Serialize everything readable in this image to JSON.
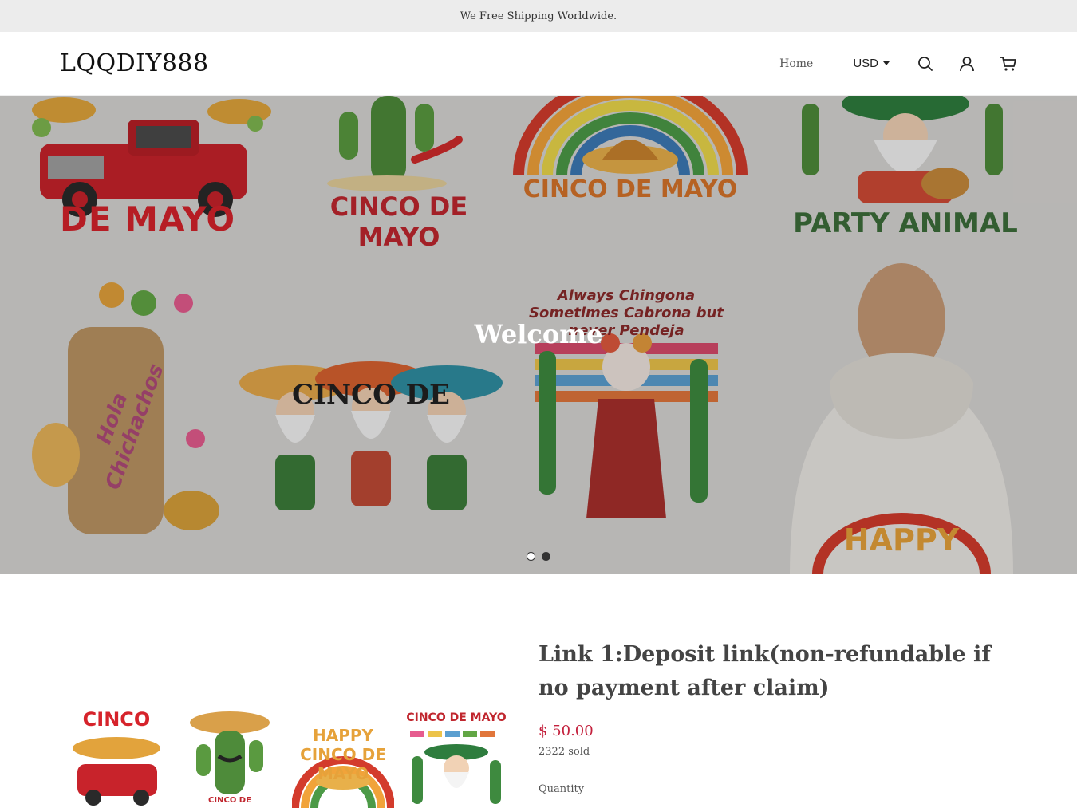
{
  "announcement": "We Free Shipping Worldwide.",
  "header": {
    "logo": "LQQDIY888",
    "nav_home": "Home",
    "currency": "USD",
    "icons": [
      "search-icon",
      "account-icon",
      "cart-icon"
    ]
  },
  "hero": {
    "title": "Welcome",
    "slides": 2,
    "active_slide": 2,
    "tiles": [
      {
        "text": "DE MAYO"
      },
      {
        "text": "CINCO DE MAYO"
      },
      {
        "text": "CINCO DE MAYO"
      },
      {
        "text": "PARTY ANIMAL"
      },
      {
        "text": "Hola Chichachos"
      },
      {
        "text": "CINCO DE MAYO"
      },
      {
        "text": "Always Chingona Sometimes Cabrona but never Pendeja"
      },
      {
        "text": "HAPPY"
      }
    ]
  },
  "product": {
    "title": "Link 1:Deposit link(non-refundable if no payment after claim)",
    "price": "$ 50.00",
    "sold": "2322 sold",
    "quantity_label": "Quantity",
    "thumbnails": [
      {
        "text": "CINCO"
      },
      {
        "text": "CINCO DE"
      },
      {
        "text": "HAPPY CINCO DE MAYO"
      },
      {
        "text": "CINCO DE MAYO"
      }
    ]
  },
  "colors": {
    "announcement_bg": "#ececec",
    "price": "#c4213d",
    "hero_bg": "#d8d6d4"
  }
}
